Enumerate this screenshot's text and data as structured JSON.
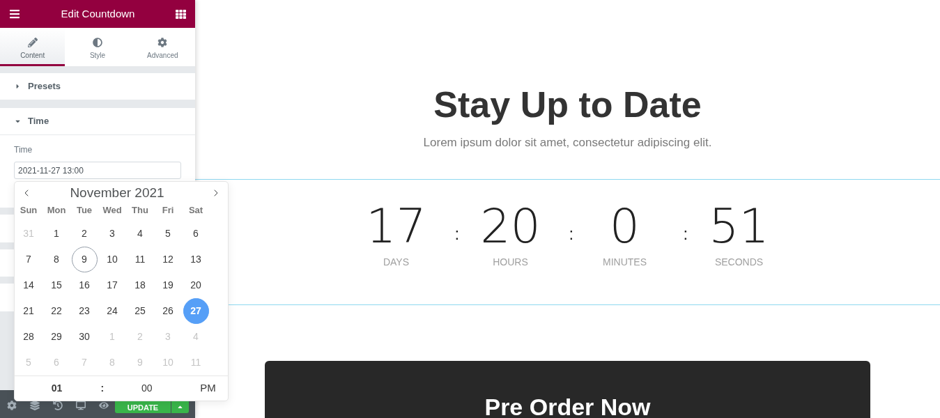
{
  "panel": {
    "title": "Edit Countdown",
    "tabs": [
      {
        "label": "Content",
        "selected": true
      },
      {
        "label": "Style",
        "selected": false
      },
      {
        "label": "Advanced",
        "selected": false
      }
    ],
    "sections": [
      {
        "title": "Presets",
        "expanded": false
      },
      {
        "title": "Time",
        "expanded": true
      }
    ],
    "time_field": {
      "label": "Time",
      "value": "2021-11-27 13:00"
    },
    "footer": {
      "update_label": "UPDATE"
    }
  },
  "datepicker": {
    "month": "November 2021",
    "weekdays": [
      "Sun",
      "Mon",
      "Tue",
      "Wed",
      "Thu",
      "Fri",
      "Sat"
    ],
    "weeks": [
      [
        {
          "day": "31",
          "muted": true,
          "today": false,
          "selected": false
        },
        {
          "day": "1",
          "muted": false,
          "today": false,
          "selected": false
        },
        {
          "day": "2",
          "muted": false,
          "today": false,
          "selected": false
        },
        {
          "day": "3",
          "muted": false,
          "today": false,
          "selected": false
        },
        {
          "day": "4",
          "muted": false,
          "today": false,
          "selected": false
        },
        {
          "day": "5",
          "muted": false,
          "today": false,
          "selected": false
        },
        {
          "day": "6",
          "muted": false,
          "today": false,
          "selected": false
        }
      ],
      [
        {
          "day": "7",
          "muted": false,
          "today": false,
          "selected": false
        },
        {
          "day": "8",
          "muted": false,
          "today": false,
          "selected": false
        },
        {
          "day": "9",
          "muted": false,
          "today": true,
          "selected": false
        },
        {
          "day": "10",
          "muted": false,
          "today": false,
          "selected": false
        },
        {
          "day": "11",
          "muted": false,
          "today": false,
          "selected": false
        },
        {
          "day": "12",
          "muted": false,
          "today": false,
          "selected": false
        },
        {
          "day": "13",
          "muted": false,
          "today": false,
          "selected": false
        }
      ],
      [
        {
          "day": "14",
          "muted": false,
          "today": false,
          "selected": false
        },
        {
          "day": "15",
          "muted": false,
          "today": false,
          "selected": false
        },
        {
          "day": "16",
          "muted": false,
          "today": false,
          "selected": false
        },
        {
          "day": "17",
          "muted": false,
          "today": false,
          "selected": false
        },
        {
          "day": "18",
          "muted": false,
          "today": false,
          "selected": false
        },
        {
          "day": "19",
          "muted": false,
          "today": false,
          "selected": false
        },
        {
          "day": "20",
          "muted": false,
          "today": false,
          "selected": false
        }
      ],
      [
        {
          "day": "21",
          "muted": false,
          "today": false,
          "selected": false
        },
        {
          "day": "22",
          "muted": false,
          "today": false,
          "selected": false
        },
        {
          "day": "23",
          "muted": false,
          "today": false,
          "selected": false
        },
        {
          "day": "24",
          "muted": false,
          "today": false,
          "selected": false
        },
        {
          "day": "25",
          "muted": false,
          "today": false,
          "selected": false
        },
        {
          "day": "26",
          "muted": false,
          "today": false,
          "selected": false
        },
        {
          "day": "27",
          "muted": false,
          "today": false,
          "selected": true
        }
      ],
      [
        {
          "day": "28",
          "muted": false,
          "today": false,
          "selected": false
        },
        {
          "day": "29",
          "muted": false,
          "today": false,
          "selected": false
        },
        {
          "day": "30",
          "muted": false,
          "today": false,
          "selected": false
        },
        {
          "day": "1",
          "muted": true,
          "today": false,
          "selected": false
        },
        {
          "day": "2",
          "muted": true,
          "today": false,
          "selected": false
        },
        {
          "day": "3",
          "muted": true,
          "today": false,
          "selected": false
        },
        {
          "day": "4",
          "muted": true,
          "today": false,
          "selected": false
        }
      ],
      [
        {
          "day": "5",
          "muted": true,
          "today": false,
          "selected": false
        },
        {
          "day": "6",
          "muted": true,
          "today": false,
          "selected": false
        },
        {
          "day": "7",
          "muted": true,
          "today": false,
          "selected": false
        },
        {
          "day": "8",
          "muted": true,
          "today": false,
          "selected": false
        },
        {
          "day": "9",
          "muted": true,
          "today": false,
          "selected": false
        },
        {
          "day": "10",
          "muted": true,
          "today": false,
          "selected": false
        },
        {
          "day": "11",
          "muted": true,
          "today": false,
          "selected": false
        }
      ]
    ],
    "time": {
      "hour": "01",
      "separator": ":",
      "minute": "00",
      "ampm": "PM"
    }
  },
  "page": {
    "heading": "Stay Up to Date",
    "subtitle": "Lorem ipsum dolor sit amet, consectetur adipiscing elit.",
    "countdown": [
      {
        "value": "17",
        "label": "DAYS"
      },
      {
        "value": "20",
        "label": "HOURS"
      },
      {
        "value": "0",
        "label": "MINUTES"
      },
      {
        "value": "51",
        "label": "SECONDS"
      }
    ],
    "separators": [
      ":",
      ":",
      ":"
    ],
    "cta": {
      "heading": "Pre Order Now"
    }
  }
}
